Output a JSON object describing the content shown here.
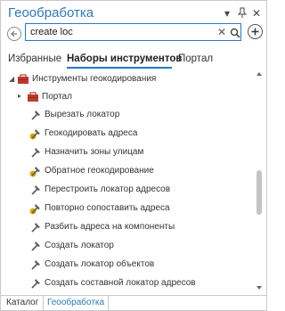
{
  "pane": {
    "title": "Геообработка"
  },
  "search": {
    "value": "create loc"
  },
  "tabs": [
    {
      "label": "Избранные",
      "active": false
    },
    {
      "label": "Наборы инструментов",
      "active": true
    },
    {
      "label": "Портал",
      "active": false
    }
  ],
  "tree": {
    "root": {
      "label": "Инструменты геокодирования",
      "icon": "toolbox-icon",
      "expanded": true
    },
    "items": [
      {
        "label": "Портал",
        "icon": "toolbox-icon",
        "expandable": true
      },
      {
        "label": "Вырезать локатор",
        "icon": "hammer-icon"
      },
      {
        "label": "Геокодировать адреса",
        "icon": "geocode-hammer-icon"
      },
      {
        "label": "Назначить зоны улицам",
        "icon": "hammer-icon"
      },
      {
        "label": "Обратное геокодирование",
        "icon": "geocode-hammer-icon"
      },
      {
        "label": "Перестроить локатор адресов",
        "icon": "hammer-icon"
      },
      {
        "label": "Повторно сопоставить адреса",
        "icon": "geocode-hammer-icon"
      },
      {
        "label": "Разбить адреса на компоненты",
        "icon": "hammer-icon"
      },
      {
        "label": "Создать локатор",
        "icon": "hammer-icon"
      },
      {
        "label": "Создать локатор объектов",
        "icon": "hammer-icon"
      },
      {
        "label": "Создать составной локатор адресов",
        "icon": "hammer-icon"
      }
    ]
  },
  "bottom_tabs": [
    {
      "label": "Каталог",
      "active": false
    },
    {
      "label": "Геообработка",
      "active": true
    }
  ],
  "colors": {
    "accent": "#2b79c2",
    "toolbox": "#c0392b",
    "hammer": "#5a5a5a",
    "geocode_badge": "#e0a800"
  }
}
